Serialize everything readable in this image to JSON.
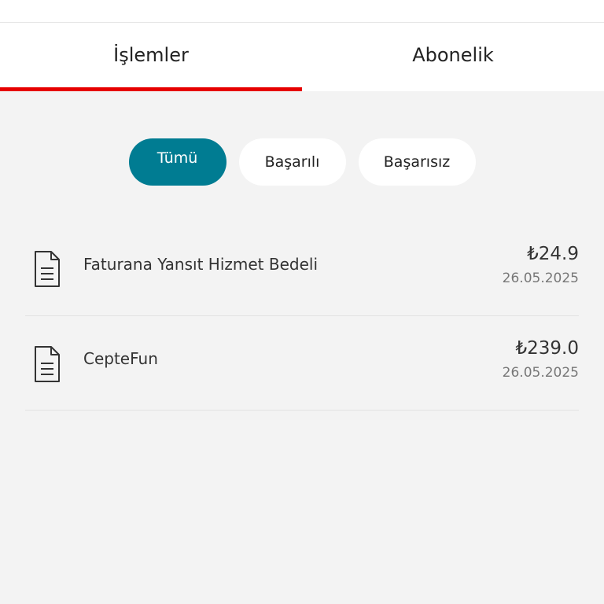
{
  "tabs": [
    {
      "label": "İşlemler",
      "active": true
    },
    {
      "label": "Abonelik",
      "active": false
    }
  ],
  "filters": [
    {
      "label": "Tümü",
      "selected": true
    },
    {
      "label": "Başarılı",
      "selected": false
    },
    {
      "label": "Başarısız",
      "selected": false
    }
  ],
  "transactions": [
    {
      "title": "Faturana Yansıt Hizmet Bedeli",
      "amount": "₺24.9",
      "date": "26.05.2025",
      "icon": "document-icon"
    },
    {
      "title": "CepteFun",
      "amount": "₺239.0",
      "date": "26.05.2025",
      "icon": "document-icon"
    }
  ],
  "colors": {
    "accent_red": "#e60000",
    "chip_selected": "#007c92",
    "background": "#f3f3f3"
  }
}
